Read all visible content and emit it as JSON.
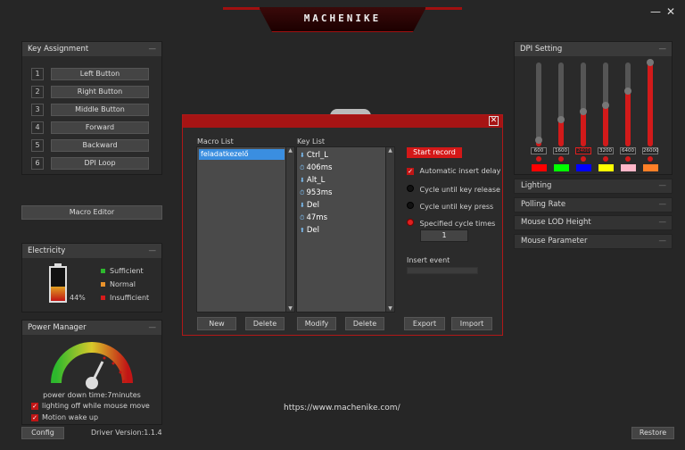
{
  "app": {
    "brand": "MACHENIKE",
    "minimize_icon": "minimize-icon",
    "close_icon": "close-icon"
  },
  "key_assignment": {
    "title": "Key Assignment",
    "rows": [
      {
        "num": "1",
        "label": "Left Button"
      },
      {
        "num": "2",
        "label": "Right Button"
      },
      {
        "num": "3",
        "label": "Middle Button"
      },
      {
        "num": "4",
        "label": "Forward"
      },
      {
        "num": "5",
        "label": "Backward"
      },
      {
        "num": "6",
        "label": "DPI Loop"
      }
    ]
  },
  "macro_editor_label": "Macro Editor",
  "electricity": {
    "title": "Electricity",
    "percent": 44,
    "percent_text": "44%",
    "legend": [
      {
        "label": "Sufficient",
        "color": "#2db82d"
      },
      {
        "label": "Normal",
        "color": "#e8922b"
      },
      {
        "label": "Insufficient",
        "color": "#d81b1b"
      }
    ]
  },
  "power_manager": {
    "title": "Power Manager",
    "power_down_text": "power down time:7minutes",
    "options": [
      {
        "label": "lighting off while mouse move",
        "checked": true
      },
      {
        "label": "Motion wake up",
        "checked": true
      }
    ]
  },
  "footer": {
    "config_label": "Config",
    "driver_version": "Driver Version:1.1.4",
    "url": "https://www.machenike.com/",
    "restore_label": "Restore"
  },
  "macro_dialog": {
    "macro_list_title": "Macro List",
    "key_list_title": "Key List",
    "macros": [
      "feladatkezelő"
    ],
    "keys": [
      {
        "icon": "key-down-icon",
        "text": "Ctrl_L"
      },
      {
        "icon": "delay-clock-icon",
        "text": "406ms"
      },
      {
        "icon": "key-down-icon",
        "text": "Alt_L"
      },
      {
        "icon": "delay-clock-icon",
        "text": "953ms"
      },
      {
        "icon": "key-down-icon",
        "text": "Del"
      },
      {
        "icon": "delay-clock-icon",
        "text": "47ms"
      },
      {
        "icon": "key-up-icon",
        "text": "Del"
      }
    ],
    "start_record_label": "Start record",
    "auto_insert_delay_label": "Automatic insert delay",
    "cycle_release_label": "Cycle until key release",
    "cycle_press_label": "Cycle until key press",
    "specified_cycle_label": "Specified cycle times",
    "cycle_times_value": "1",
    "insert_event_label": "Insert event",
    "buttons": {
      "new": "New",
      "delete_macro": "Delete",
      "modify": "Modify",
      "delete_key": "Delete",
      "export": "Export",
      "import": "Import"
    }
  },
  "dpi_setting": {
    "title": "DPI Setting",
    "max": 26000,
    "levels": [
      {
        "value": 600,
        "label": "600",
        "color": "#ff0000"
      },
      {
        "value": 1600,
        "label": "1600",
        "color": "#00ff00"
      },
      {
        "value": 2400,
        "label": "2400",
        "color": "#0000ff",
        "selected": true
      },
      {
        "value": 3200,
        "label": "3200",
        "color": "#ffff00"
      },
      {
        "value": 6400,
        "label": "6400",
        "color": "#ffb6c8"
      },
      {
        "value": 26000,
        "label": "26000",
        "color": "#ff7f27"
      }
    ]
  },
  "side_sections": [
    "Lighting",
    "Polling Rate",
    "Mouse LOD Height",
    "Mouse Parameter"
  ]
}
